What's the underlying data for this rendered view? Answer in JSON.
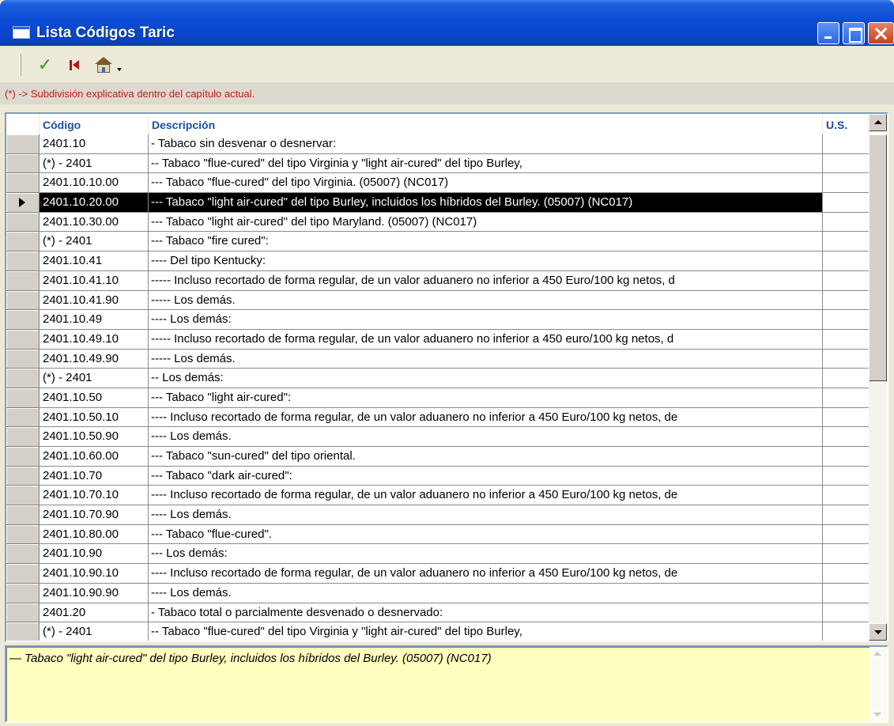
{
  "window": {
    "title": "Lista Códigos Taric"
  },
  "toolbar": {
    "buttons": [
      {
        "icon": "check-icon"
      },
      {
        "icon": "first-record-icon"
      },
      {
        "icon": "home-icon"
      }
    ]
  },
  "info": {
    "text": "(*) -> Subdivisión explicativa dentro del capítulo actual."
  },
  "grid": {
    "columns": {
      "code": "Código",
      "description": "Descripción",
      "us": "U.S."
    },
    "selected_index": 3,
    "rows": [
      {
        "code": "2401.10",
        "description": "- Tabaco sin desvenar o desnervar:",
        "us": ""
      },
      {
        "code": "(*) - 2401",
        "description": "-- Tabaco \"flue-cured\" del tipo Virginia y \"light air-cured\" del tipo Burley,",
        "us": ""
      },
      {
        "code": "2401.10.10.00",
        "description": "--- Tabaco \"flue-cured\" del tipo Virginia. (05007) (NC017)",
        "us": ""
      },
      {
        "code": "2401.10.20.00",
        "description": "--- Tabaco \"light air-cured\" del tipo Burley, incluidos los híbridos del Burley. (05007) (NC017)",
        "us": ""
      },
      {
        "code": "2401.10.30.00",
        "description": "--- Tabaco \"light air-cured\" del tipo Maryland. (05007) (NC017)",
        "us": ""
      },
      {
        "code": "(*) - 2401",
        "description": "--- Tabaco \"fire cured\":",
        "us": ""
      },
      {
        "code": "2401.10.41",
        "description": "---- Del tipo Kentucky:",
        "us": ""
      },
      {
        "code": "2401.10.41.10",
        "description": "----- Incluso recortado de forma regular, de un valor aduanero no inferior a 450 Euro/100 kg netos, d",
        "us": ""
      },
      {
        "code": "2401.10.41.90",
        "description": "----- Los demás.",
        "us": ""
      },
      {
        "code": "2401.10.49",
        "description": "---- Los demás:",
        "us": ""
      },
      {
        "code": "2401.10.49.10",
        "description": "----- Incluso recortado de forma regular, de un valor aduanero no inferior a 450 euro/100 kg netos, d",
        "us": ""
      },
      {
        "code": "2401.10.49.90",
        "description": "----- Los demás.",
        "us": ""
      },
      {
        "code": "(*) - 2401",
        "description": "-- Los demás:",
        "us": ""
      },
      {
        "code": "2401.10.50",
        "description": "--- Tabaco \"light air-cured\":",
        "us": ""
      },
      {
        "code": "2401.10.50.10",
        "description": "---- Incluso recortado de forma regular, de un valor aduanero no inferior a 450 Euro/100 kg netos, de",
        "us": ""
      },
      {
        "code": "2401.10.50.90",
        "description": "---- Los demás.",
        "us": ""
      },
      {
        "code": "2401.10.60.00",
        "description": "--- Tabaco \"sun-cured\" del tipo oriental.",
        "us": ""
      },
      {
        "code": "2401.10.70",
        "description": "--- Tabaco \"dark air-cured\":",
        "us": ""
      },
      {
        "code": "2401.10.70.10",
        "description": "---- Incluso recortado de forma regular, de un valor aduanero no inferior a 450 Euro/100 kg netos, de",
        "us": ""
      },
      {
        "code": "2401.10.70.90",
        "description": "---- Los demás.",
        "us": ""
      },
      {
        "code": "2401.10.80.00",
        "description": "--- Tabaco \"flue-cured\".",
        "us": ""
      },
      {
        "code": "2401.10.90",
        "description": "--- Los demás:",
        "us": ""
      },
      {
        "code": "2401.10.90.10",
        "description": "---- Incluso recortado de forma regular, de un valor aduanero no inferior a 450 Euro/100 kg netos, de",
        "us": ""
      },
      {
        "code": "2401.10.90.90",
        "description": "---- Los demás.",
        "us": ""
      },
      {
        "code": "2401.20",
        "description": "- Tabaco total o parcialmente desvenado o desnervado:",
        "us": ""
      },
      {
        "code": "(*) - 2401",
        "description": "-- Tabaco \"flue-cured\" del tipo Virginia y \"light air-cured\" del tipo Burley,",
        "us": ""
      }
    ]
  },
  "memo": {
    "text": "— Tabaco \"light air-cured\" del tipo Burley, incluidos los híbridos del Burley. (05007) (NC017)"
  }
}
